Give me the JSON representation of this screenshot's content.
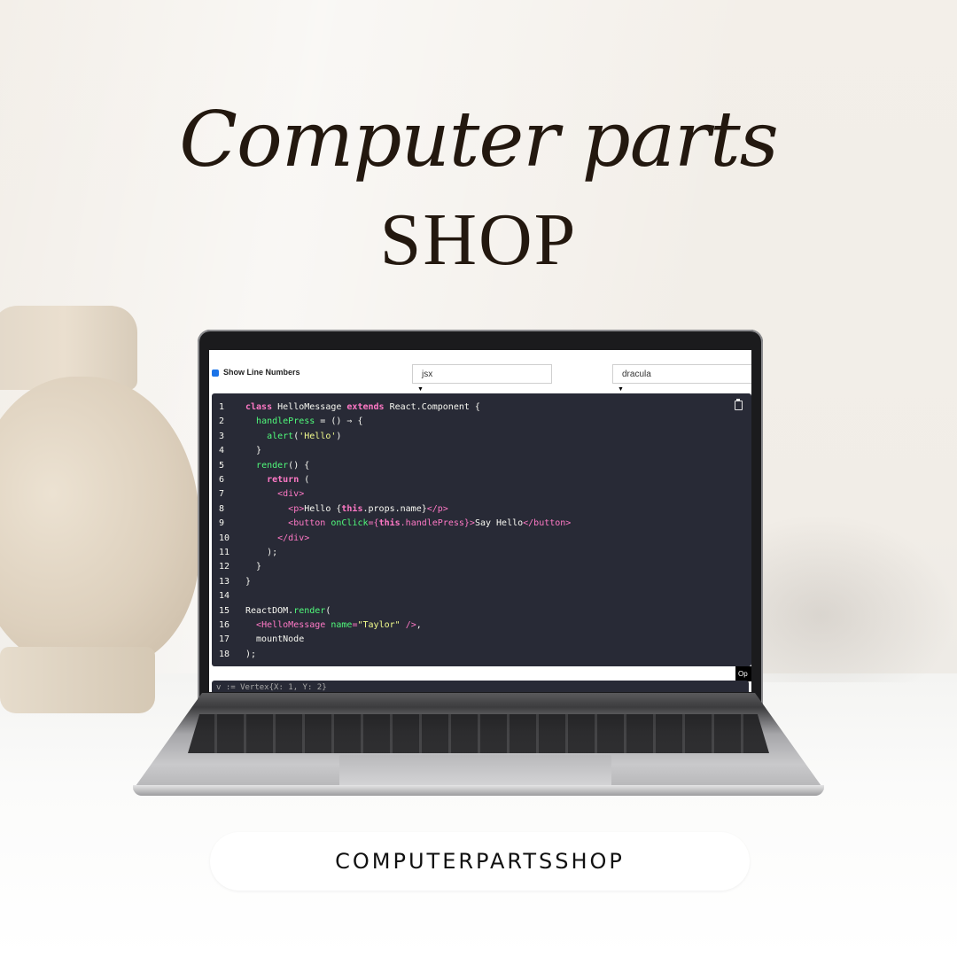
{
  "header": {
    "title_script": "Computer parts",
    "title_caps": "SHOP"
  },
  "editor": {
    "show_line_numbers_label": "Show Line Numbers",
    "show_line_numbers_checked": true,
    "language_select": "jsx",
    "theme_select": "dracula",
    "open_button_label": "Op",
    "code_lines": [
      [
        {
          "t": "kw",
          "v": "class"
        },
        {
          "t": "plain",
          "v": " HelloMessage "
        },
        {
          "t": "kw",
          "v": "extends"
        },
        {
          "t": "plain",
          "v": " React.Component {"
        }
      ],
      [
        {
          "t": "plain",
          "v": "  "
        },
        {
          "t": "fn",
          "v": "handlePress"
        },
        {
          "t": "plain",
          "v": " = () ⇒ {"
        }
      ],
      [
        {
          "t": "plain",
          "v": "    "
        },
        {
          "t": "fn",
          "v": "alert"
        },
        {
          "t": "plain",
          "v": "("
        },
        {
          "t": "str",
          "v": "'Hello'"
        },
        {
          "t": "plain",
          "v": ")"
        }
      ],
      [
        {
          "t": "plain",
          "v": "  }"
        }
      ],
      [
        {
          "t": "plain",
          "v": "  "
        },
        {
          "t": "fn",
          "v": "render"
        },
        {
          "t": "plain",
          "v": "() {"
        }
      ],
      [
        {
          "t": "plain",
          "v": "    "
        },
        {
          "t": "kw",
          "v": "return"
        },
        {
          "t": "plain",
          "v": " ("
        }
      ],
      [
        {
          "t": "plain",
          "v": "      "
        },
        {
          "t": "tag",
          "v": "<div>"
        }
      ],
      [
        {
          "t": "plain",
          "v": "        "
        },
        {
          "t": "tag",
          "v": "<p>"
        },
        {
          "t": "plain",
          "v": "Hello {"
        },
        {
          "t": "kw",
          "v": "this"
        },
        {
          "t": "plain",
          "v": ".props.name}"
        },
        {
          "t": "tag",
          "v": "</p>"
        }
      ],
      [
        {
          "t": "plain",
          "v": "        "
        },
        {
          "t": "tag",
          "v": "<button"
        },
        {
          "t": "plain",
          "v": " "
        },
        {
          "t": "attr",
          "v": "onClick"
        },
        {
          "t": "tag",
          "v": "={"
        },
        {
          "t": "kw",
          "v": "this"
        },
        {
          "t": "tag",
          "v": ".handlePress}>"
        },
        {
          "t": "plain",
          "v": "Say Hello"
        },
        {
          "t": "tag",
          "v": "</button>"
        }
      ],
      [
        {
          "t": "plain",
          "v": "      "
        },
        {
          "t": "tag",
          "v": "</div>"
        }
      ],
      [
        {
          "t": "plain",
          "v": "    );"
        }
      ],
      [
        {
          "t": "plain",
          "v": "  }"
        }
      ],
      [
        {
          "t": "plain",
          "v": "}"
        }
      ],
      [
        {
          "t": "plain",
          "v": ""
        }
      ],
      [
        {
          "t": "plain",
          "v": "ReactDOM."
        },
        {
          "t": "fn",
          "v": "render"
        },
        {
          "t": "plain",
          "v": "("
        }
      ],
      [
        {
          "t": "plain",
          "v": "  "
        },
        {
          "t": "tag",
          "v": "<HelloMessage"
        },
        {
          "t": "plain",
          "v": " "
        },
        {
          "t": "attr",
          "v": "name"
        },
        {
          "t": "tag",
          "v": "="
        },
        {
          "t": "val",
          "v": "\"Taylor\""
        },
        {
          "t": "plain",
          "v": " "
        },
        {
          "t": "tag",
          "v": "/>"
        },
        {
          "t": "plain",
          "v": ","
        }
      ],
      [
        {
          "t": "plain",
          "v": "  mountNode"
        }
      ],
      [
        {
          "t": "plain",
          "v": ");"
        }
      ]
    ],
    "second_panel_text": "v := Vertex{X: 1, Y: 2}"
  },
  "footer": {
    "pill_label": "COMPUTERPARTSSHOP"
  },
  "colors": {
    "code_bg": "#282a36",
    "keyword": "#ff79c6",
    "function": "#50fa7b",
    "string": "#f1fa8c",
    "text_dark": "#23180f"
  }
}
